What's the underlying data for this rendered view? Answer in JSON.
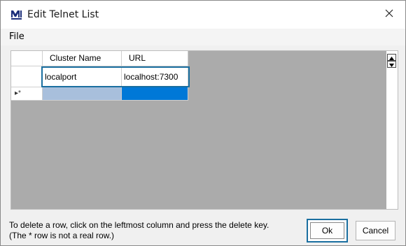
{
  "window": {
    "title": "Edit Telnet List",
    "icon": "app-logo-icon",
    "close_icon": "close-icon"
  },
  "menu": {
    "items": [
      {
        "label": "File"
      }
    ]
  },
  "grid": {
    "columns": [
      {
        "label": "Cluster Name"
      },
      {
        "label": "URL"
      }
    ],
    "rows": [
      {
        "cluster_name": "localport",
        "url": "localhost:7300"
      }
    ],
    "new_row_marker": "▸*"
  },
  "footer": {
    "help_line_1": "To delete a row, click on the leftmost column and press the delete key.",
    "help_line_2": "(The * row is not a real row.)",
    "ok_label": "Ok",
    "cancel_label": "Cancel"
  }
}
